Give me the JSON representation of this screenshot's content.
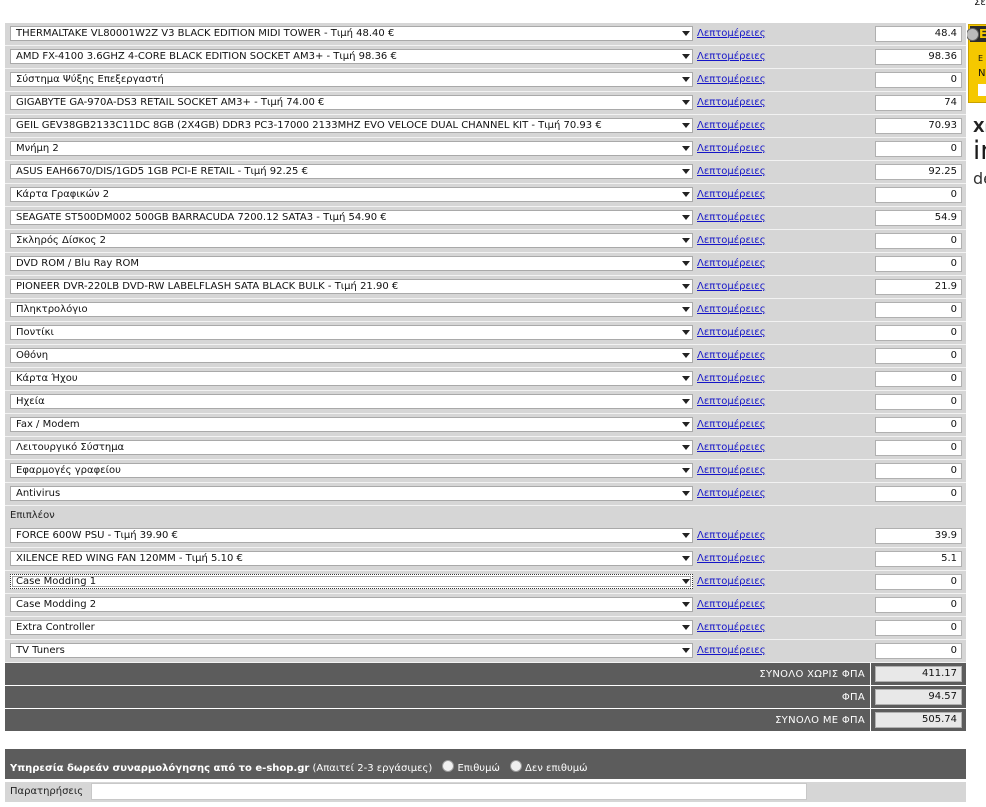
{
  "components": [
    {
      "label": "THERMALTAKE VL80001W2Z V3 BLACK EDITION MIDI TOWER - Τιμή 48.40 €",
      "price": "48.4"
    },
    {
      "label": "AMD FX-4100 3.6GHZ 4-CORE BLACK EDITION SOCKET AM3+ - Τιμή 98.36 €",
      "price": "98.36"
    },
    {
      "label": "Σύστημα Ψύξης Επεξεργαστή",
      "price": "0"
    },
    {
      "label": "GIGABYTE GA-970A-DS3 RETAIL SOCKET AM3+ - Τιμή 74.00 €",
      "price": "74"
    },
    {
      "label": "GEIL GEV38GB2133C11DC 8GB (2X4GB) DDR3 PC3-17000 2133MHZ EVO VELOCE DUAL CHANNEL KIT - Τιμή 70.93 €",
      "price": "70.93"
    },
    {
      "label": "Μνήμη 2",
      "price": "0"
    },
    {
      "label": "ASUS EAH6670/DIS/1GD5 1GB PCI-E RETAIL - Τιμή 92.25 €",
      "price": "92.25"
    },
    {
      "label": "Κάρτα Γραφικών 2",
      "price": "0"
    },
    {
      "label": "SEAGATE ST500DM002 500GB BARRACUDA 7200.12 SATA3 - Τιμή 54.90 €",
      "price": "54.9"
    },
    {
      "label": "Σκληρός Δίσκος 2",
      "price": "0"
    },
    {
      "label": "DVD ROM / Blu Ray ROM",
      "price": "0"
    },
    {
      "label": "PIONEER DVR-220LB DVD-RW LABELFLASH SATA BLACK BULK - Τιμή 21.90 €",
      "price": "21.9"
    },
    {
      "label": "Πληκτρολόγιο",
      "price": "0"
    },
    {
      "label": "Ποντίκι",
      "price": "0"
    },
    {
      "label": "Οθόνη",
      "price": "0"
    },
    {
      "label": "Κάρτα Ήχου",
      "price": "0"
    },
    {
      "label": "Ηχεία",
      "price": "0"
    },
    {
      "label": "Fax / Modem",
      "price": "0"
    },
    {
      "label": "Λειτουργικό Σύστημα",
      "price": "0"
    },
    {
      "label": "Εφαρμογές γραφείου",
      "price": "0"
    },
    {
      "label": "Antivirus",
      "price": "0"
    }
  ],
  "extras_label": "Επιπλέον",
  "extras": [
    {
      "label": "FORCE 600W PSU - Τιμή 39.90 €",
      "price": "39.9"
    },
    {
      "label": "XILENCE RED WING FAN 120MM - Τιμή 5.10 €",
      "price": "5.1"
    },
    {
      "label": "Case Modding 1",
      "price": "0",
      "focused": true
    },
    {
      "label": "Case Modding 2",
      "price": "0"
    },
    {
      "label": "Extra Controller",
      "price": "0"
    },
    {
      "label": "TV Tuners",
      "price": "0"
    }
  ],
  "details_link": "Λεπτομέρειες",
  "totals": [
    {
      "label": "ΣΥΝΟΛΟ ΧΩΡΙΣ ΦΠΑ",
      "value": "411.17"
    },
    {
      "label": "ΦΠΑ",
      "value": "94.57"
    },
    {
      "label": "ΣΥΝΟΛΟ ΜΕ ΦΠΑ",
      "value": "505.74"
    }
  ],
  "assembly": {
    "title": "Υπηρεσία δωρεάν συναρμολόγησης από το e-shop.gr",
    "note": "(Απαιτεί 2-3 εργάσιμες)",
    "option_yes": "Επιθυμώ",
    "option_no": "Δεν επιθυμώ"
  },
  "notes_label": "Παρατηρήσεις",
  "side": {
    "top_text": "Σε",
    "dark_letter": "E",
    "small1": "E",
    "small2": "N",
    "big1": "Xı",
    "big2": "in",
    "big3": "de"
  },
  "colors": {
    "row_bg": "#d6d6d6",
    "dark_bar": "#5c5c5c",
    "link": "#1515c8",
    "side_yellow": "#f5c800"
  }
}
